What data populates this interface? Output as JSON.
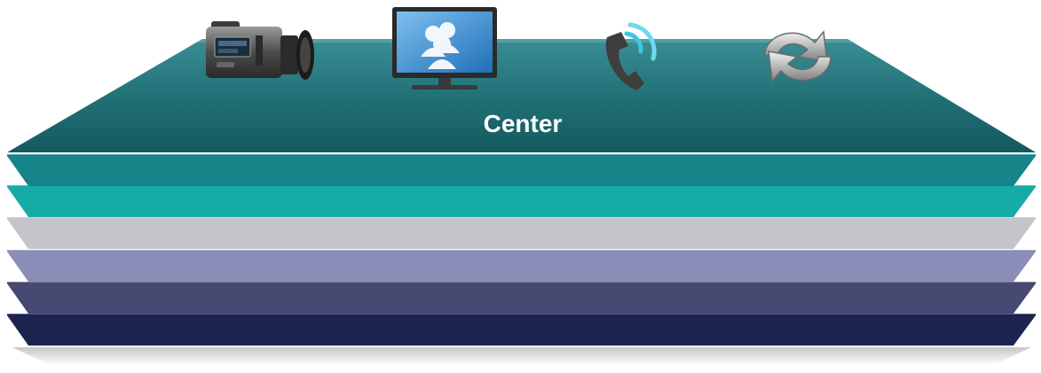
{
  "diagram": {
    "top_label": "Center",
    "icons": [
      {
        "name": "video-camera-icon"
      },
      {
        "name": "monitor-users-icon"
      },
      {
        "name": "phone-call-icon"
      },
      {
        "name": "sync-arrows-icon"
      }
    ],
    "layers": [
      {
        "name": "layer-7-bottom",
        "color": "#1e2450"
      },
      {
        "name": "layer-6",
        "color": "#464a72"
      },
      {
        "name": "layer-5",
        "color": "#8a8db8"
      },
      {
        "name": "layer-4",
        "color": "#c4c4ca"
      },
      {
        "name": "layer-3",
        "color": "#17aba8"
      },
      {
        "name": "layer-2",
        "color": "#15858a"
      },
      {
        "name": "layer-1-top",
        "color": "#1d6d72"
      }
    ]
  }
}
